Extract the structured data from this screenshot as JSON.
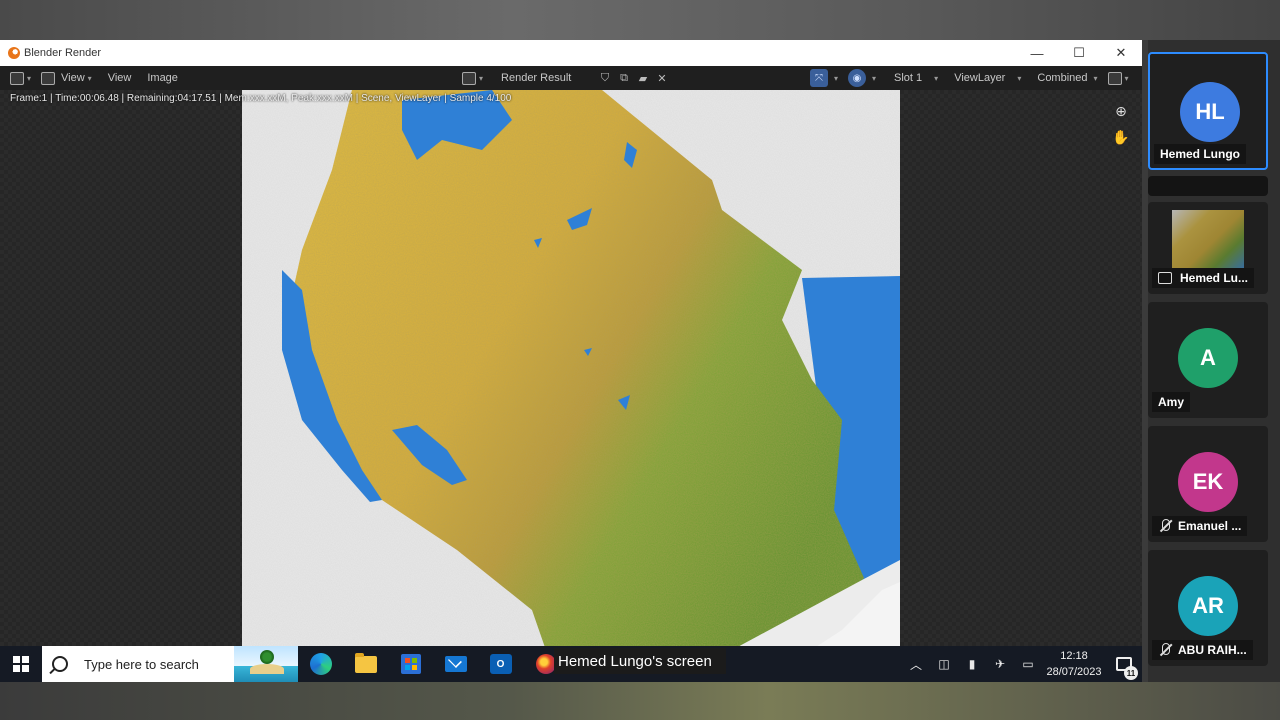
{
  "window": {
    "title": "Blender Render",
    "controls": {
      "minimize": "—",
      "maximize": "☐",
      "close": "✕"
    }
  },
  "toolbar": {
    "view_menu": "View",
    "view_label": "View",
    "image_label": "Image",
    "render_result": "Render Result",
    "slot": "Slot 1",
    "view_layer": "ViewLayer",
    "pass": "Combined"
  },
  "status": {
    "text": "Frame:1 | Time:00:06.48 | Remaining:04:17.51 | Mem:xxx.xxM, Peak:xxx.xxM | Scene, ViewLayer | Sample 4/100"
  },
  "viewport": {
    "zoom_icon": "zoom-in-icon",
    "pan_icon": "hand-pan-icon",
    "image_colors": {
      "land_yellow": "#d9b23c",
      "land_green": "#6f9c33",
      "water": "#2f80d6",
      "background": "#ececec"
    }
  },
  "taskbar": {
    "search_placeholder": "Type here to search",
    "apps": [
      "edge-icon",
      "file-explorer-icon",
      "store-icon",
      "mail-icon",
      "outlook-icon",
      "browser-icon"
    ],
    "outlook_letter": "O",
    "time": "12:18",
    "date": "28/07/2023",
    "notification_count": "11"
  },
  "share_banner": "Hemed Lungo's screen",
  "participants": [
    {
      "initials": "HL",
      "name": "Hemed Lungo",
      "color": "#3d7be0",
      "muted": false,
      "active": true
    },
    {
      "initials": "",
      "name": "Hemed Lu...",
      "color": "",
      "muted": false,
      "sharing": true
    },
    {
      "initials": "A",
      "name": "Amy",
      "color": "#1fa06a",
      "muted": false
    },
    {
      "initials": "EK",
      "name": "Emanuel ...",
      "color": "#c2378c",
      "muted": true
    },
    {
      "initials": "AR",
      "name": "ABU RAIH...",
      "color": "#1aa3b8",
      "muted": true
    }
  ]
}
